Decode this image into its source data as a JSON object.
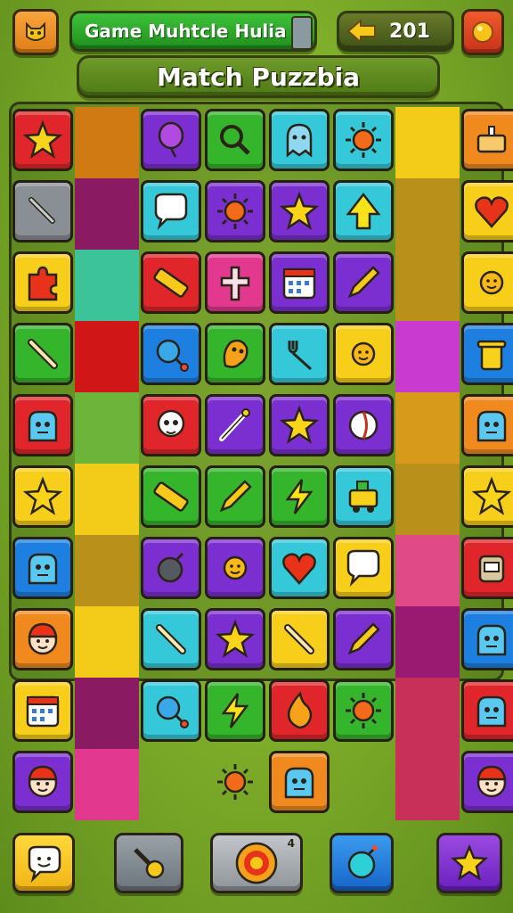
{
  "header": {
    "mode_label": "Game Muhtcle Hulia",
    "coins": "201",
    "title": "Match Puzzbia"
  },
  "icons": {
    "menu": "cat-face-icon",
    "coin": "arrow-left-coin-icon",
    "settings": "orange-circle-icon"
  },
  "colors": {
    "red": "#e0262b",
    "orange": "#f08a1e",
    "yellow": "#f7cf1a",
    "green": "#35b52b",
    "teal": "#34c8d8",
    "blue": "#1d7fe0",
    "purple": "#7b2fd0",
    "pink": "#e2398f",
    "gray": "#8a8f96"
  },
  "board": {
    "rows": [
      [
        "red:star-icon",
        "block:#cf7a12",
        "purple:balloon-icon",
        "green:magnifier-icon",
        "teal:ghost-icon",
        "teal:sun-icon",
        "block:#f2cc18",
        "orange:cake-icon"
      ],
      [
        "gray:wrench-icon",
        "block:#8a1a62",
        "teal:speech-bubble-icon",
        "purple:sun-icon",
        "purple:star-icon",
        "teal:arrow-up-icon",
        "block:#b8901a",
        "yellow:heart-icon"
      ],
      [
        "yellow:puzzle-piece-icon",
        "block:#3cc39a",
        "red:ruler-icon",
        "pink:cross-icon",
        "purple:calendar-icon",
        "purple:pencil-icon",
        "block:#b8901a",
        "yellow:sun-face-icon"
      ],
      [
        "green:bone-icon",
        "block:#d01616",
        "blue:lollipop-icon",
        "green:creature-icon",
        "teal:fork-icon",
        "yellow:sun-face-icon",
        "block:#c83ad0",
        "blue:trash-can-icon"
      ],
      [
        "red:monster-icon",
        "block:#6db43a",
        "red:skull-icon",
        "purple:wand-icon",
        "purple:star-icon",
        "purple:ball-icon",
        "block:#d89a1a",
        "orange:monster-icon"
      ],
      [
        "yellow:star-icon",
        "block:#f2cc18",
        "green:ruler-icon",
        "green:pencil-icon",
        "green:lightning-icon",
        "teal:train-icon",
        "block:#b8901a",
        "yellow:star-icon"
      ],
      [
        "blue:monster-icon",
        "block:#b8901a",
        "purple:bomb-icon",
        "purple:sun-face-icon",
        "teal:heart-icon",
        "yellow:speech-bubble-icon",
        "block:#e04a86",
        "red:robot-icon"
      ],
      [
        "orange:face-icon",
        "block:#f2cc18",
        "teal:bone-icon",
        "purple:star-icon",
        "yellow:bone-icon",
        "purple:pencil-icon",
        "block:#9a1a72",
        "blue:monster-icon"
      ],
      [
        "yellow:calendar-icon",
        "block:#8a1a62",
        "teal:lollipop-icon",
        "green:lightning-icon",
        "red:flame-icon",
        "green:sun-icon",
        "block:#c8305a",
        "red:monster-icon"
      ],
      [
        "purple:face-icon",
        "block:#e2398f",
        "empty",
        "plain:sun-icon",
        "orange:monster-icon",
        "empty",
        "block:#c8305a",
        "purple:face-icon"
      ]
    ]
  },
  "bottom": {
    "badge": "4",
    "buttons": [
      "speech-bubble-icon",
      "key-icon",
      "target-icon",
      "bomb-icon",
      "star-icon"
    ]
  }
}
